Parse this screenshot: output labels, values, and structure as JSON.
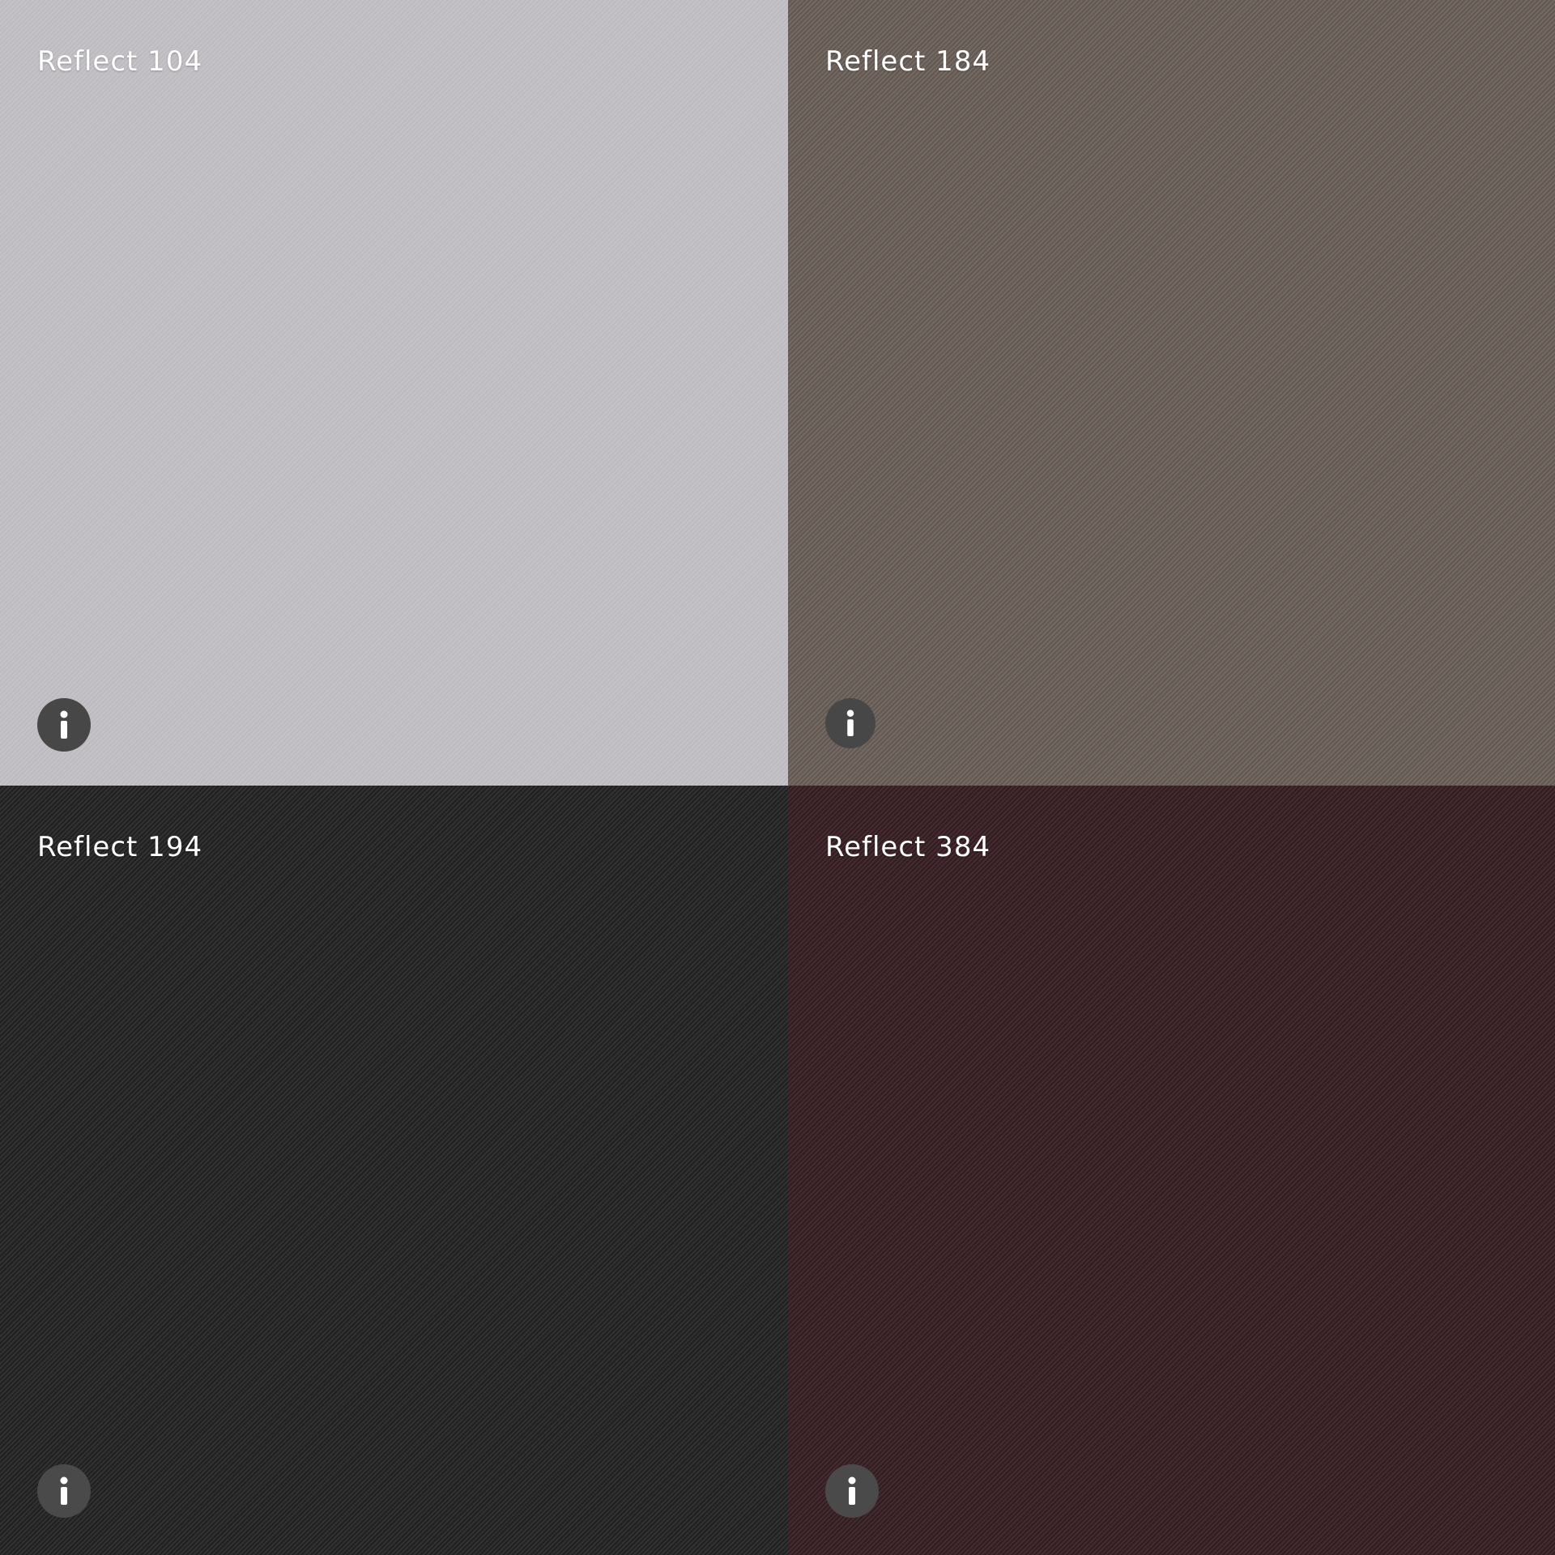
{
  "swatches": [
    {
      "label": "Reflect 104",
      "color": "#c2c0c4",
      "info_icon": "info-icon",
      "info_button_color": "#474747"
    },
    {
      "label": "Reflect 184",
      "color": "#6a5f58",
      "info_icon": "info-icon",
      "info_button_color": "#474747"
    },
    {
      "label": "Reflect 194",
      "color": "#252525",
      "info_icon": "info-icon",
      "info_button_color": "#4a4a4a"
    },
    {
      "label": "Reflect 384",
      "color": "#3a2126",
      "info_icon": "info-icon",
      "info_button_color": "#4a4a4a"
    }
  ]
}
